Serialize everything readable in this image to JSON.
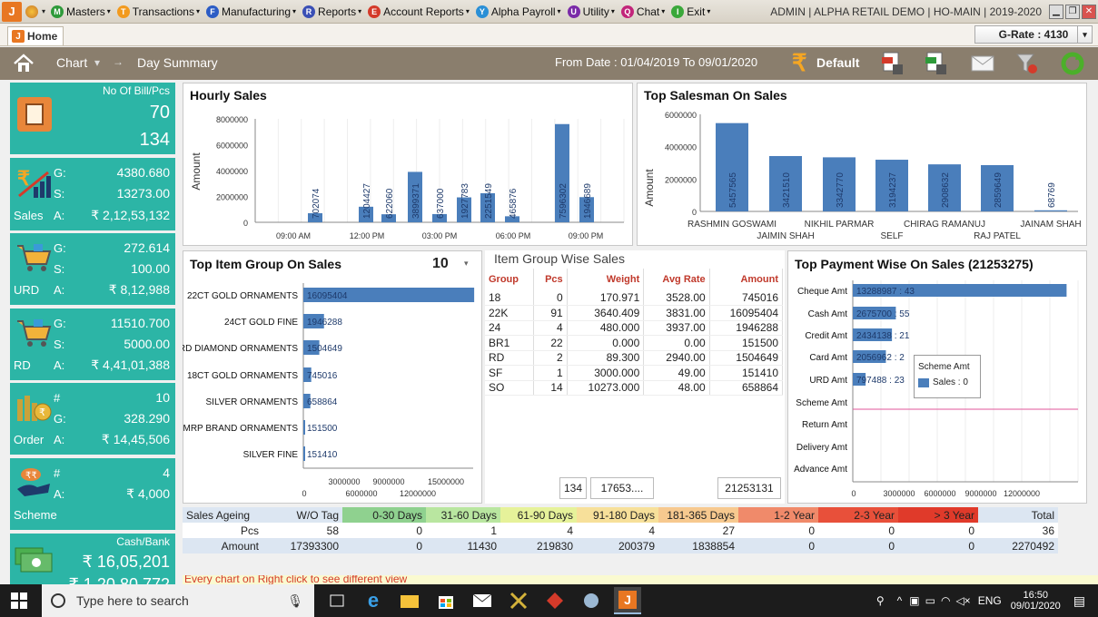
{
  "menubar": {
    "items": [
      {
        "label": "Masters",
        "color": "#2e9a3a",
        "glyph": "M"
      },
      {
        "label": "Transactions",
        "color": "#f29a1e",
        "glyph": "T"
      },
      {
        "label": "Manufacturing",
        "color": "#2c5cc5",
        "glyph": "F"
      },
      {
        "label": "Reports",
        "color": "#3a4fb5",
        "glyph": "R"
      },
      {
        "label": "Account Reports",
        "color": "#d43a2a",
        "glyph": "E"
      },
      {
        "label": "Alpha Payroll",
        "color": "#2a8fd6",
        "glyph": "Y"
      },
      {
        "label": "Utility",
        "color": "#7a2aa8",
        "glyph": "U"
      },
      {
        "label": "Chat",
        "color": "#c2257a",
        "glyph": "Q"
      },
      {
        "label": "Exit",
        "color": "#3aa83a",
        "glyph": "I"
      }
    ],
    "window_title": "ADMIN | ALPHA RETAIL DEMO | HO-MAIN | 2019-2020"
  },
  "tabs": {
    "home": "Home",
    "grate": "G-Rate : 4130"
  },
  "toolbar": {
    "chart": "Chart",
    "day_summary": "Day Summary",
    "date_range": "From Date : 01/04/2019 To 09/01/2020",
    "default": "Default"
  },
  "cards": {
    "bill": {
      "title": "No Of Bill/Pcs",
      "v1": "70",
      "v2": "134"
    },
    "sales": {
      "g_lbl": "G:",
      "s_lbl": "S:",
      "a_lbl": "A:",
      "name": "Sales",
      "g": "4380.680",
      "s": "13273.00",
      "a": "₹ 2,12,53,132"
    },
    "urd": {
      "g_lbl": "G:",
      "s_lbl": "S:",
      "a_lbl": "A:",
      "name": "URD",
      "g": "272.614",
      "s": "100.00",
      "a": "₹ 8,12,988"
    },
    "rd": {
      "g_lbl": "G:",
      "s_lbl": "S:",
      "a_lbl": "A:",
      "name": "RD",
      "g": "11510.700",
      "s": "5000.00",
      "a": "₹ 4,41,01,388"
    },
    "order": {
      "n_lbl": "#",
      "g_lbl": "G:",
      "a_lbl": "A:",
      "name": "Order",
      "n": "10",
      "g": "328.290",
      "a": "₹ 14,45,506"
    },
    "scheme": {
      "n_lbl": "#",
      "a_lbl": "A:",
      "name": "Scheme",
      "n": "4",
      "a": "₹ 4,000"
    },
    "cash": {
      "title": "Cash/Bank",
      "v1": "₹ 16,05,201",
      "v2": "₹ 1,20,80,772"
    }
  },
  "hourly_sales": {
    "title": "Hourly Sales"
  },
  "top_salesman": {
    "title": "Top Salesman On Sales"
  },
  "top_item_group": {
    "title": "Top Item Group On Sales",
    "count": "10"
  },
  "item_group_wise": {
    "title": "Item Group Wise Sales",
    "headers": [
      "Group",
      "Pcs",
      "Weight",
      "Avg Rate",
      "Amount"
    ],
    "rows": [
      [
        "18",
        "0",
        "170.971",
        "3528.00",
        "745016"
      ],
      [
        "22K",
        "91",
        "3640.409",
        "3831.00",
        "16095404"
      ],
      [
        "24",
        "4",
        "480.000",
        "3937.00",
        "1946288"
      ],
      [
        "BR1",
        "22",
        "0.000",
        "0.00",
        "151500"
      ],
      [
        "RD",
        "2",
        "89.300",
        "2940.00",
        "1504649"
      ],
      [
        "SF",
        "1",
        "3000.000",
        "49.00",
        "151410"
      ],
      [
        "SO",
        "14",
        "10273.000",
        "48.00",
        "658864"
      ]
    ],
    "totals": {
      "pcs": "134",
      "weight": "17653....",
      "amount": "21253131"
    }
  },
  "top_payment": {
    "title": "Top Payment Wise On Sales (21253275)",
    "tooltip_title": "Scheme Amt",
    "tooltip_series": "Sales : 0"
  },
  "ageing": {
    "headers": [
      "Sales Ageing",
      "W/O Tag",
      "0-30 Days",
      "31-60 Days",
      "61-90 Days",
      "91-180 Days",
      "181-365 Days",
      "1-2 Year",
      "2-3 Year",
      "> 3 Year",
      "Total"
    ],
    "header_colors": [
      "#dce6f2",
      "#dce6f2",
      "#8fd18f",
      "#b9e6a0",
      "#e6f29a",
      "#f7e09a",
      "#f7c98f",
      "#f08a6a",
      "#e8503a",
      "#e03a2a",
      "#dce6f2"
    ],
    "rows": [
      [
        "Pcs",
        "58",
        "0",
        "1",
        "4",
        "4",
        "27",
        "0",
        "0",
        "0",
        "36"
      ],
      [
        "Amount",
        "17393300",
        "0",
        "11430",
        "219830",
        "200379",
        "1838854",
        "0",
        "0",
        "0",
        "2270492"
      ]
    ]
  },
  "footer_note": "Every chart on Right click to see different view",
  "taskbar": {
    "search": "Type here to search",
    "lang": "ENG",
    "time": "16:50",
    "date": "09/01/2020"
  },
  "chart_data": [
    {
      "type": "bar",
      "title": "Hourly Sales",
      "ylabel": "Amount",
      "ylim": [
        0,
        8000000
      ],
      "yticks": [
        "0",
        "2000000",
        "4000000",
        "6000000",
        "8000000"
      ],
      "xticks": [
        "09:00 AM",
        "12:00 PM",
        "03:00 PM",
        "06:00 PM",
        "09:00 PM"
      ],
      "values": [
        702074,
        1204427,
        622060,
        3899371,
        637000,
        1927783,
        2251549,
        465876,
        7596302,
        1946689
      ]
    },
    {
      "type": "bar",
      "title": "Top Salesman On Sales",
      "ylabel": "Amount",
      "ylim": [
        0,
        6000000
      ],
      "yticks": [
        "0",
        "2000000",
        "4000000",
        "6000000"
      ],
      "categories": [
        "RASHMIN GOSWAMI",
        "JAIMIN SHAH",
        "NIKHIL PARMAR",
        "SELF",
        "CHIRAG RAMANUJ",
        "RAJ PATEL",
        "JAINAM SHAH"
      ],
      "values": [
        5457565,
        3421510,
        3342770,
        3194237,
        2908632,
        2859649,
        68769
      ]
    },
    {
      "type": "bar",
      "title": "Top Item Group On Sales",
      "xlim": [
        0,
        16000000
      ],
      "xticks_top": [
        "3000000",
        "9000000",
        "15000000"
      ],
      "xticks_bottom": [
        "0",
        "6000000",
        "12000000"
      ],
      "categories": [
        "22CT GOLD ORNAMENTS",
        "24CT GOLD FINE",
        "RD DIAMOND ORNAMENTS",
        "18CT GOLD ORNAMENTS",
        "SILVER ORNAMENTS",
        "MRP BRAND ORNAMENTS",
        "SILVER FINE"
      ],
      "values": [
        16095404,
        1946288,
        1504649,
        745016,
        658864,
        151500,
        151410
      ]
    },
    {
      "type": "bar",
      "title": "Top Payment Wise On Sales (21253275)",
      "xlim": [
        0,
        14000000
      ],
      "xticks": [
        "0",
        "3000000",
        "6000000",
        "9000000",
        "12000000"
      ],
      "categories": [
        "Cheque Amt",
        "Cash Amt",
        "Credit Amt",
        "Card Amt",
        "URD Amt",
        "Scheme Amt",
        "Return Amt",
        "Delivery Amt",
        "Advance Amt"
      ],
      "labels": [
        "13288987 : 43",
        "2675700 : 55",
        "2434138 : 21",
        "2056962 : 2",
        "797488 : 23",
        "",
        "",
        "",
        ""
      ],
      "values": [
        13288987,
        2675700,
        2434138,
        2056962,
        797488,
        0,
        0,
        0,
        0
      ]
    }
  ]
}
